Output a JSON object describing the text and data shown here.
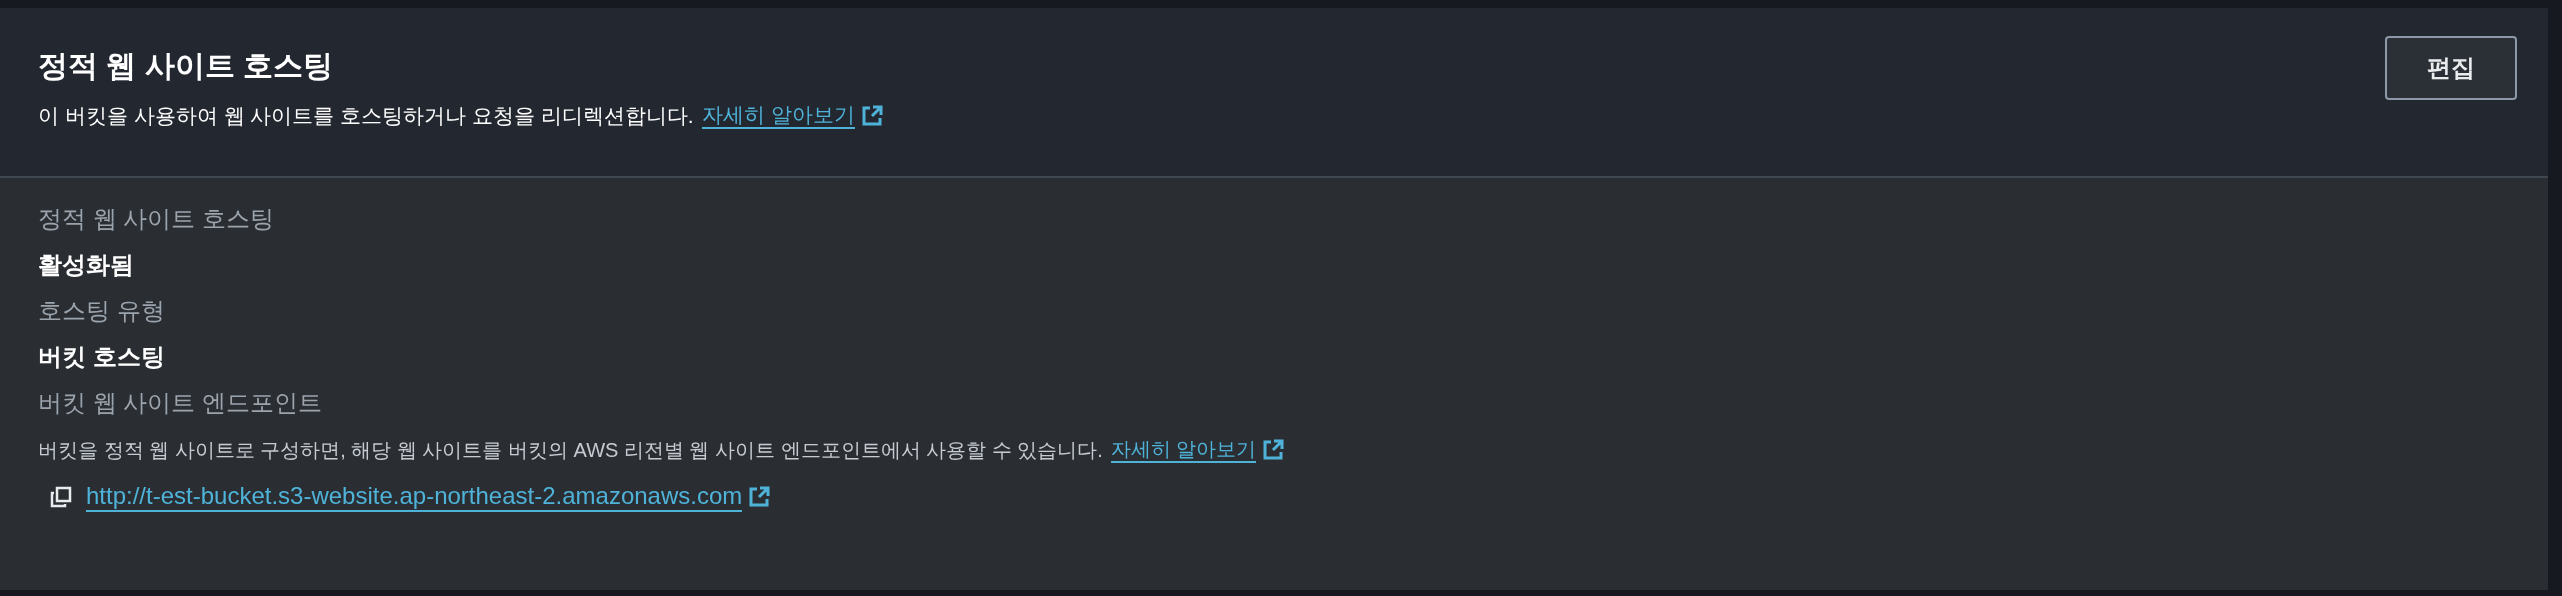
{
  "panel": {
    "title": "정적 웹 사이트 호스팅",
    "description": "이 버킷을 사용하여 웹 사이트를 호스팅하거나 요청을 리디렉션합니다.",
    "learn_more": "자세히 알아보기",
    "edit_button": "편집"
  },
  "properties": [
    {
      "label": "정적 웹 사이트 호스팅",
      "value": "활성화됨"
    },
    {
      "label": "호스팅 유형",
      "value": "버킷 호스팅"
    }
  ],
  "endpoint": {
    "label": "버킷 웹 사이트 엔드포인트",
    "description": "버킷을 정적 웹 사이트로 구성하면, 해당 웹 사이트를 버킷의 AWS 리전별 웹 사이트 엔드포인트에서 사용할 수 있습니다.",
    "learn_more": "자세히 알아보기",
    "url": "http://t-est-bucket.s3-website.ap-northeast-2.amazonaws.com"
  }
}
